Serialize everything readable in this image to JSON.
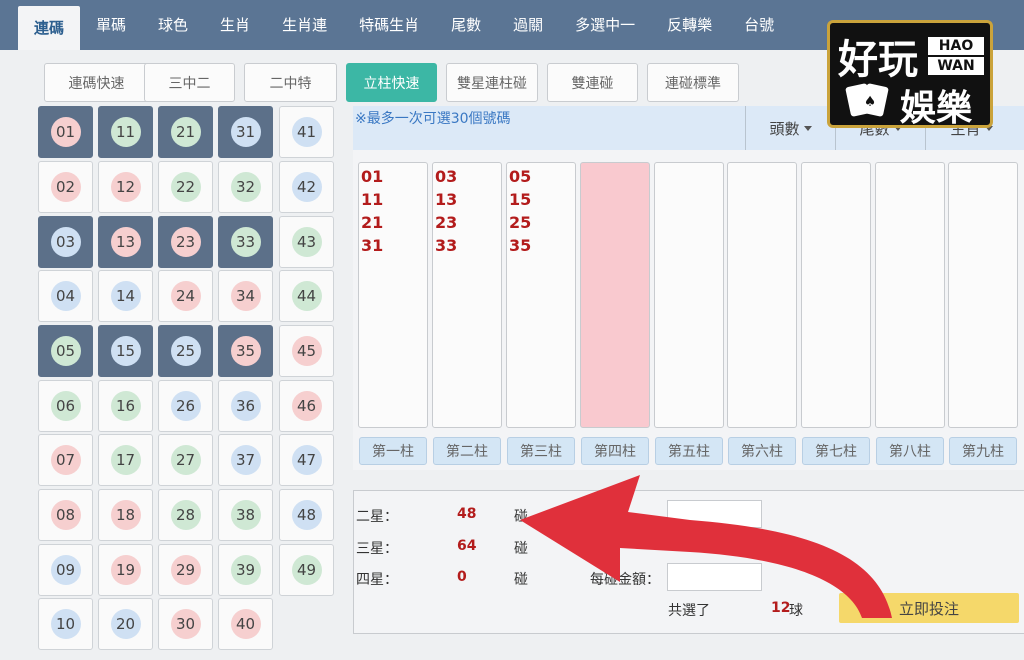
{
  "nav": {
    "tabs": [
      "連碼",
      "單碼",
      "球色",
      "生肖",
      "生肖連",
      "特碼生肖",
      "尾數",
      "過關",
      "多選中一",
      "反轉樂",
      "台號"
    ],
    "active_index": 0
  },
  "sub_buttons": [
    "連碼快速",
    "三中二",
    "二中特",
    "立柱快速",
    "雙星連柱碰",
    "雙連碰",
    "連碰標準"
  ],
  "sub_active_index": 3,
  "numbers": [
    [
      "01",
      "11",
      "21",
      "31",
      "41"
    ],
    [
      "02",
      "12",
      "22",
      "32",
      "42"
    ],
    [
      "03",
      "13",
      "23",
      "33",
      "43"
    ],
    [
      "04",
      "14",
      "24",
      "34",
      "44"
    ],
    [
      "05",
      "15",
      "25",
      "35",
      "45"
    ],
    [
      "06",
      "16",
      "26",
      "36",
      "46"
    ],
    [
      "07",
      "17",
      "27",
      "37",
      "47"
    ],
    [
      "08",
      "18",
      "28",
      "38",
      "48"
    ],
    [
      "09",
      "19",
      "29",
      "39",
      "49"
    ],
    [
      "10",
      "20",
      "30",
      "40"
    ]
  ],
  "ball_colors": {
    "01": "red",
    "11": "green",
    "21": "green",
    "31": "blue",
    "41": "blue",
    "02": "red",
    "12": "red",
    "22": "green",
    "32": "green",
    "42": "blue",
    "03": "blue",
    "13": "red",
    "23": "red",
    "33": "green",
    "43": "green",
    "04": "blue",
    "14": "blue",
    "24": "red",
    "34": "red",
    "44": "green",
    "05": "green",
    "15": "blue",
    "25": "blue",
    "35": "red",
    "45": "red",
    "06": "green",
    "16": "green",
    "26": "blue",
    "36": "blue",
    "46": "red",
    "07": "red",
    "17": "green",
    "27": "green",
    "37": "blue",
    "47": "blue",
    "08": "red",
    "18": "red",
    "28": "green",
    "38": "green",
    "48": "blue",
    "09": "blue",
    "19": "red",
    "29": "red",
    "39": "green",
    "49": "green",
    "10": "blue",
    "20": "blue",
    "30": "red",
    "40": "red"
  },
  "selected_numbers": [
    "01",
    "11",
    "21",
    "31",
    "03",
    "13",
    "23",
    "33",
    "05",
    "15",
    "25",
    "35"
  ],
  "info_note": "※最多一次可選30個號碼",
  "filters": [
    "頭數",
    "尾數",
    "生肖"
  ],
  "columns": {
    "entries": [
      [
        "01",
        "11",
        "21",
        "31"
      ],
      [
        "03",
        "13",
        "23",
        "33"
      ],
      [
        "05",
        "15",
        "25",
        "35"
      ],
      [],
      [],
      [],
      [],
      [],
      []
    ],
    "highlight_index": 3,
    "labels": [
      "第一柱",
      "第二柱",
      "第三柱",
      "第四柱",
      "第五柱",
      "第六柱",
      "第七柱",
      "第八柱",
      "第九柱"
    ]
  },
  "stats": {
    "rows": [
      {
        "label": "二星：",
        "value": "48",
        "unit": "碰"
      },
      {
        "label": "三星：",
        "value": "64",
        "unit": "碰"
      },
      {
        "label": "四星：",
        "value": "0",
        "unit": "碰"
      }
    ],
    "per_bet_label": "每碰金額：",
    "selected_prefix": "共選了",
    "selected_count": "12",
    "selected_suffix": "球",
    "submit_label": "立即投注"
  },
  "logo": {
    "cn_top": "好玩",
    "en_top": "HAO",
    "en_bottom": "WAN",
    "cn_bottom": "娛樂"
  },
  "colors": {
    "nav_bg": "#5b7594",
    "accent": "#3cb7a5",
    "selected_cell": "#5c7089",
    "number_red": "#b31c1c",
    "arrow": "#e0303b",
    "submit": "#f5d86a"
  }
}
